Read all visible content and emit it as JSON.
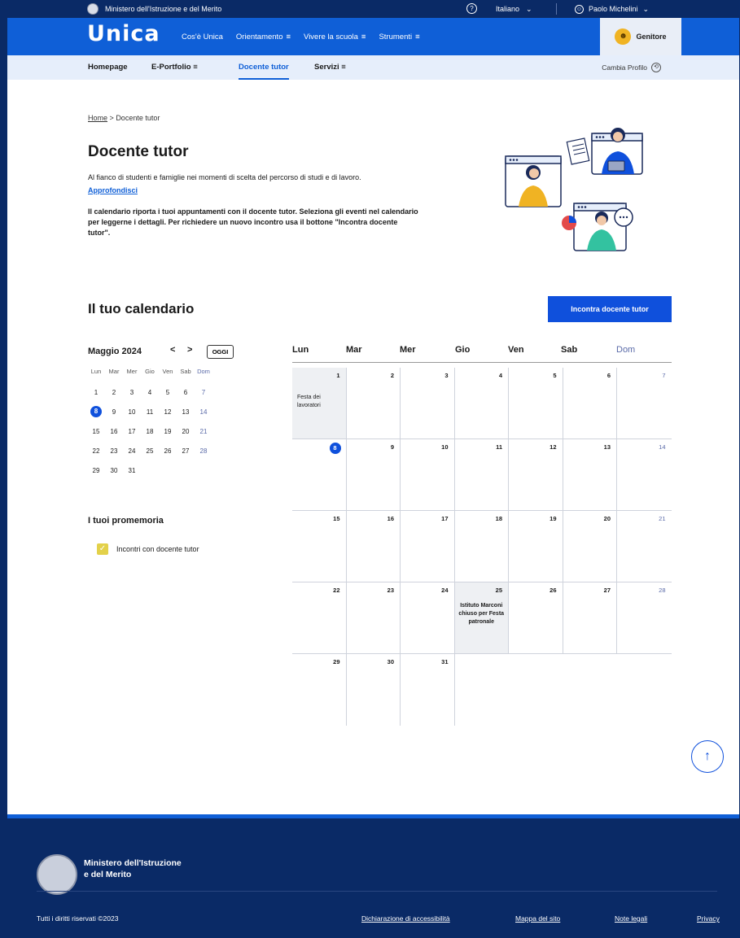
{
  "topbar": {
    "institution": "Ministero dell'Istruzione e del Merito",
    "help_icon": "question-icon",
    "language": "Italiano",
    "user_name": "Paolo Michelini"
  },
  "mainnav": {
    "logo": "Unica",
    "links": [
      "Cos'è Unica",
      "Orientamento",
      "Vivere la scuola",
      "Strumenti"
    ],
    "profile_badge": "Genitore"
  },
  "subnav": {
    "items": [
      "Homepage",
      "E-Portfolio",
      "Docente tutor",
      "Servizi"
    ],
    "active": "Docente tutor",
    "change_profile": "Cambia Profilo"
  },
  "breadcrumb": {
    "home": "Home",
    "separator": ">",
    "current": "Docente tutor"
  },
  "page": {
    "title": "Docente tutor",
    "intro": "Al fianco di studenti e famiglie nei momenti di scelta del percorso di studi e di lavoro.",
    "more_link": "Approfondisci",
    "description": "Il calendario riporta i tuoi appuntamenti con il docente tutor. Seleziona gli eventi nel calendario per leggerne i dettagli. Per richiedere un nuovo incontro usa il bottone \"Incontra docente tutor\"."
  },
  "calendar": {
    "title": "Il tuo calendario",
    "cta": "Incontra docente tutor",
    "month_label": "Maggio 2024",
    "prev": "<",
    "next": ">",
    "today_button": "OGGI",
    "mini_weekdays": [
      "Lun",
      "Mar",
      "Mer",
      "Gio",
      "Ven",
      "Sab",
      "Dom"
    ],
    "weekdays": [
      "Lun",
      "Mar",
      "Mer",
      "Gio",
      "Ven",
      "Sab",
      "Dom"
    ],
    "weeks": [
      [
        "1",
        "2",
        "3",
        "4",
        "5",
        "6",
        "7"
      ],
      [
        "8",
        "9",
        "10",
        "11",
        "12",
        "13",
        "14"
      ],
      [
        "15",
        "16",
        "17",
        "18",
        "19",
        "20",
        "21"
      ],
      [
        "22",
        "23",
        "24",
        "25",
        "26",
        "27",
        "28"
      ],
      [
        "29",
        "30",
        "31",
        "",
        "",
        "",
        ""
      ]
    ],
    "today": "8",
    "events": [
      {
        "day": "1",
        "text": "Festa dei lavoratori"
      },
      {
        "day": "25",
        "text": "Istituto Marconi chiuso per Festa patronale"
      }
    ],
    "reminders_title": "I tuoi promemoria",
    "reminders": [
      "Incontri con docente tutor"
    ]
  },
  "footer": {
    "institution_line1": "Ministero dell'Istruzione",
    "institution_line2": "e del Merito",
    "copyright": "Tutti i diritti riservati ©2023",
    "links": [
      "Dichiarazione di accessibilità",
      "Mappa del sito",
      "Note legali",
      "Privacy"
    ]
  },
  "colors": {
    "primary": "#0f5fd7",
    "dark": "#0a2a66",
    "button": "#0f50dc",
    "accent_yellow": "#e3d14a"
  }
}
